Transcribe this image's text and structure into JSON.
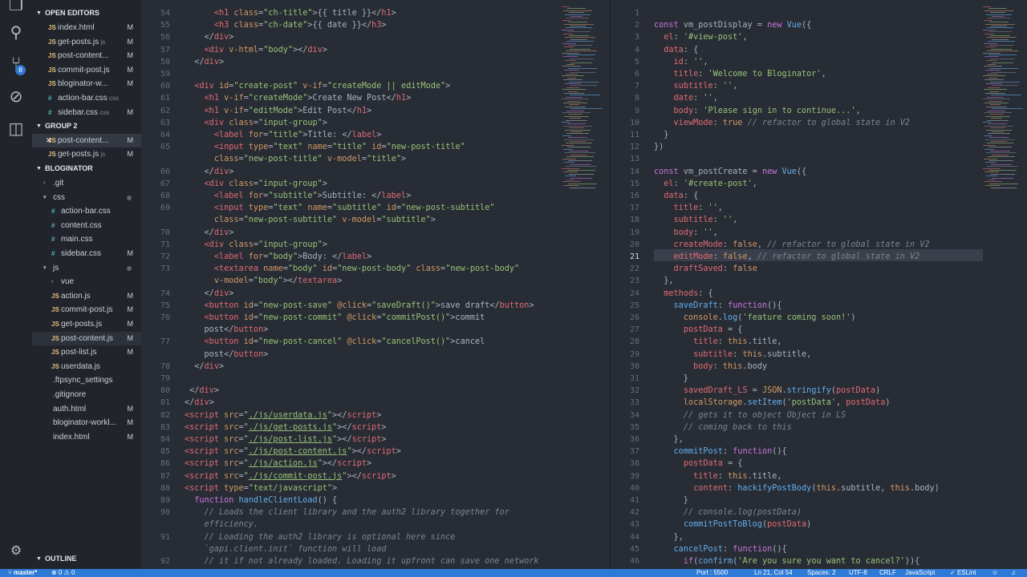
{
  "sidebar": {
    "open_editors": "OPEN EDITORS",
    "group2": "GROUP 2",
    "project": "BLOGINATOR",
    "outline": "OUTLINE",
    "open_files": [
      {
        "icon": "JS",
        "name": "index.html",
        "ext": "",
        "status": "M",
        "type": "html"
      },
      {
        "icon": "JS",
        "name": "get-posts.js",
        "ext": "js",
        "status": "M",
        "type": "js"
      },
      {
        "icon": "JS",
        "name": "post-content...",
        "ext": "",
        "status": "M",
        "type": "js"
      },
      {
        "icon": "JS",
        "name": "commit-post.js",
        "ext": "",
        "status": "M",
        "type": "js"
      },
      {
        "icon": "JS",
        "name": "bloginator-w...",
        "ext": "",
        "status": "M",
        "type": "js"
      },
      {
        "icon": "#",
        "name": "action-bar.css",
        "ext": "css",
        "status": "",
        "type": "css"
      },
      {
        "icon": "#",
        "name": "sidebar.css",
        "ext": "css",
        "status": "M",
        "type": "css"
      }
    ],
    "group2_files": [
      {
        "icon": "JS",
        "name": "post-content...",
        "status": "M"
      },
      {
        "icon": "JS",
        "name": "get-posts.js",
        "ext": "js",
        "status": "M"
      }
    ],
    "tree": [
      {
        "name": ".git",
        "indent": 1,
        "folder": true,
        "status": ""
      },
      {
        "name": "css",
        "indent": 1,
        "folder": true,
        "open": true,
        "status": "dot"
      },
      {
        "name": "action-bar.css",
        "indent": 2,
        "icon": "#",
        "status": ""
      },
      {
        "name": "content.css",
        "indent": 2,
        "icon": "#",
        "status": ""
      },
      {
        "name": "main.css",
        "indent": 2,
        "icon": "#",
        "status": ""
      },
      {
        "name": "sidebar.css",
        "indent": 2,
        "icon": "#",
        "status": "M"
      },
      {
        "name": "js",
        "indent": 1,
        "folder": true,
        "open": true,
        "status": "dot"
      },
      {
        "name": "vue",
        "indent": 2,
        "folder": true,
        "status": ""
      },
      {
        "name": "action.js",
        "indent": 2,
        "icon": "JS",
        "status": "M"
      },
      {
        "name": "commit-post.js",
        "indent": 2,
        "icon": "JS",
        "status": "M"
      },
      {
        "name": "get-posts.js",
        "indent": 2,
        "icon": "JS",
        "status": "M"
      },
      {
        "name": "post-content.js",
        "indent": 2,
        "icon": "JS",
        "status": "M"
      },
      {
        "name": "post-list.js",
        "indent": 2,
        "icon": "JS",
        "status": "M"
      },
      {
        "name": "userdata.js",
        "indent": 2,
        "icon": "JS",
        "status": ""
      },
      {
        "name": ".ftpsync_settings",
        "indent": 1,
        "icon": "",
        "status": ""
      },
      {
        "name": ".gitignore",
        "indent": 1,
        "icon": "",
        "status": ""
      },
      {
        "name": "auth.html",
        "indent": 1,
        "icon": "",
        "status": "M"
      },
      {
        "name": "bloginator-workl...",
        "indent": 1,
        "icon": "",
        "status": "M"
      },
      {
        "name": "index.html",
        "indent": 1,
        "icon": "",
        "status": "M"
      }
    ]
  },
  "status": {
    "branch": "master*",
    "errors": "0",
    "warnings": "0",
    "port": "Port : 5500",
    "position": "Ln 21, Col 54",
    "spaces": "Spaces: 2",
    "encoding": "UTF-8",
    "eol": "CRLF",
    "language": "JavaScript",
    "linter": "ESLint"
  },
  "editor1": {
    "lines": [
      {
        "n": "54",
        "h": "      <span class=t>&lt;h1</span> <span class=a>class</span>=<span class=s>\"ch-title\"</span>&gt;{{ title }}&lt;/<span class=t>h1</span>&gt;"
      },
      {
        "n": "55",
        "h": "      <span class=t>&lt;h3</span> <span class=a>class</span>=<span class=s>\"ch-date\"</span>&gt;{{ date }}&lt;/<span class=t>h3</span>&gt;"
      },
      {
        "n": "56",
        "h": "    &lt;/<span class=t>div</span>&gt;"
      },
      {
        "n": "57",
        "h": "    <span class=t>&lt;div</span> <span class=a>v-html</span>=<span class=s>\"body\"</span>&gt;&lt;/<span class=t>div</span>&gt;"
      },
      {
        "n": "58",
        "h": "  &lt;/<span class=t>div</span>&gt;"
      },
      {
        "n": "59",
        "h": ""
      },
      {
        "n": "60",
        "h": "  <span class=t>&lt;div</span> <span class=a>id</span>=<span class=s>\"create-post\"</span> <span class=a>v-if</span>=<span class=s>\"createMode || editMode\"</span>&gt;"
      },
      {
        "n": "61",
        "h": "    <span class=t>&lt;h1</span> <span class=a>v-if</span>=<span class=s>\"createMode\"</span>&gt;Create New Post&lt;/<span class=t>h1</span>&gt;"
      },
      {
        "n": "62",
        "h": "    <span class=t>&lt;h1</span> <span class=a>v-if</span>=<span class=s>\"editMode\"</span>&gt;Edit Post&lt;/<span class=t>h1</span>&gt;"
      },
      {
        "n": "63",
        "h": "    <span class=t>&lt;div</span> <span class=a>class</span>=<span class=s>\"input-group\"</span>&gt;"
      },
      {
        "n": "64",
        "h": "      <span class=t>&lt;label</span> <span class=a>for</span>=<span class=s>\"title\"</span>&gt;Title: &lt;/<span class=t>label</span>&gt;"
      },
      {
        "n": "65",
        "h": "      <span class=t>&lt;input</span> <span class=a>type</span>=<span class=s>\"text\"</span> <span class=a>name</span>=<span class=s>\"title\"</span> <span class=a>id</span>=<span class=s>\"new-post-title\"</span>"
      },
      {
        "n": "",
        "h": "      <span class=a>class</span>=<span class=s>\"new-post-title\"</span> <span class=a>v-model</span>=<span class=s>\"title\"</span>&gt;"
      },
      {
        "n": "66",
        "h": "    &lt;/<span class=t>div</span>&gt;"
      },
      {
        "n": "67",
        "h": "    <span class=t>&lt;div</span> <span class=a>class</span>=<span class=s>\"input-group\"</span>&gt;"
      },
      {
        "n": "68",
        "h": "      <span class=t>&lt;label</span> <span class=a>for</span>=<span class=s>\"subtitle\"</span>&gt;Subtitle: &lt;/<span class=t>label</span>&gt;"
      },
      {
        "n": "69",
        "h": "      <span class=t>&lt;input</span> <span class=a>type</span>=<span class=s>\"text\"</span> <span class=a>name</span>=<span class=s>\"subtitle\"</span> <span class=a>id</span>=<span class=s>\"new-post-subtitle\"</span>"
      },
      {
        "n": "",
        "h": "      <span class=a>class</span>=<span class=s>\"new-post-subtitle\"</span> <span class=a>v-model</span>=<span class=s>\"subtitle\"</span>&gt;"
      },
      {
        "n": "70",
        "h": "    &lt;/<span class=t>div</span>&gt;"
      },
      {
        "n": "71",
        "h": "    <span class=t>&lt;div</span> <span class=a>class</span>=<span class=s>\"input-group\"</span>&gt;"
      },
      {
        "n": "72",
        "h": "      <span class=t>&lt;label</span> <span class=a>for</span>=<span class=s>\"body\"</span>&gt;Body: &lt;/<span class=t>label</span>&gt;"
      },
      {
        "n": "73",
        "h": "      <span class=t>&lt;textarea</span> <span class=a>name</span>=<span class=s>\"body\"</span> <span class=a>id</span>=<span class=s>\"new-post-body\"</span> <span class=a>class</span>=<span class=s>\"new-post-body\"</span>"
      },
      {
        "n": "",
        "h": "      <span class=a>v-model</span>=<span class=s>\"body\"</span>&gt;&lt;/<span class=t>textarea</span>&gt;"
      },
      {
        "n": "74",
        "h": "    &lt;/<span class=t>div</span>&gt;"
      },
      {
        "n": "75",
        "h": "    <span class=t>&lt;button</span> <span class=a>id</span>=<span class=s>\"new-post-save\"</span> <span class=a>@click</span>=<span class=s>\"saveDraft()\"</span>&gt;save draft&lt;/<span class=t>button</span>&gt;"
      },
      {
        "n": "76",
        "h": "    <span class=t>&lt;button</span> <span class=a>id</span>=<span class=s>\"new-post-commit\"</span> <span class=a>@click</span>=<span class=s>\"commitPost()\"</span>&gt;commit"
      },
      {
        "n": "",
        "h": "    post&lt;/<span class=t>button</span>&gt;"
      },
      {
        "n": "77",
        "h": "    <span class=t>&lt;button</span> <span class=a>id</span>=<span class=s>\"new-post-cancel\"</span> <span class=a>@click</span>=<span class=s>\"cancelPost()\"</span>&gt;cancel"
      },
      {
        "n": "",
        "h": "    post&lt;/<span class=t>button</span>&gt;"
      },
      {
        "n": "78",
        "h": "  &lt;/<span class=t>div</span>&gt;"
      },
      {
        "n": "79",
        "h": ""
      },
      {
        "n": "80",
        "h": " &lt;/<span class=t>div</span>&gt;"
      },
      {
        "n": "81",
        "h": "&lt;/<span class=t>div</span>&gt;"
      },
      {
        "n": "82",
        "h": "<span class=t>&lt;script</span> <span class=a>src</span>=<span class=s>\"</span><span class=u>./js/userdata.js</span><span class=s>\"</span>&gt;&lt;/<span class=t>script</span>&gt;"
      },
      {
        "n": "83",
        "h": "<span class=t>&lt;script</span> <span class=a>src</span>=<span class=s>\"</span><span class=u>./js/get-posts.js</span><span class=s>\"</span>&gt;&lt;/<span class=t>script</span>&gt;"
      },
      {
        "n": "84",
        "h": "<span class=t>&lt;script</span> <span class=a>src</span>=<span class=s>\"</span><span class=u>./js/post-list.js</span><span class=s>\"</span>&gt;&lt;/<span class=t>script</span>&gt;"
      },
      {
        "n": "85",
        "h": "<span class=t>&lt;script</span> <span class=a>src</span>=<span class=s>\"</span><span class=u>./js/post-content.js</span><span class=s>\"</span>&gt;&lt;/<span class=t>script</span>&gt;"
      },
      {
        "n": "86",
        "h": "<span class=t>&lt;script</span> <span class=a>src</span>=<span class=s>\"</span><span class=u>./js/action.js</span><span class=s>\"</span>&gt;&lt;/<span class=t>script</span>&gt;"
      },
      {
        "n": "87",
        "h": "<span class=t>&lt;script</span> <span class=a>src</span>=<span class=s>\"</span><span class=u>./js/commit-post.js</span><span class=s>\"</span>&gt;&lt;/<span class=t>script</span>&gt;"
      },
      {
        "n": "88",
        "h": "<span class=t>&lt;script</span> <span class=a>type</span>=<span class=s>\"text/javascript\"</span>&gt;"
      },
      {
        "n": "89",
        "h": "  <span class=k>function</span> <span class=f>handleClientLoad</span>() {"
      },
      {
        "n": "90",
        "h": "    <span class=c>// Loads the client library and the auth2 library together for</span>"
      },
      {
        "n": "",
        "h": "    <span class=c>efficiency.</span>"
      },
      {
        "n": "91",
        "h": "    <span class=c>// Loading the auth2 library is optional here since</span>"
      },
      {
        "n": "",
        "h": "    <span class=c>`gapi.client.init` function will load</span>"
      },
      {
        "n": "92",
        "h": "    <span class=c>// it if not already loaded. Loading it upfront can save one network</span>"
      }
    ]
  },
  "editor2": {
    "lines": [
      {
        "n": "1",
        "h": ""
      },
      {
        "n": "2",
        "h": "<span class=k>const</span> vm_postDisplay = <span class=k>new</span> <span class=f>Vue</span>({"
      },
      {
        "n": "3",
        "h": "  <span class=i>el</span>: <span class=s>'#view-post'</span>,"
      },
      {
        "n": "4",
        "h": "  <span class=i>data</span>: {"
      },
      {
        "n": "5",
        "h": "    <span class=i>id</span>: <span class=s>''</span>,"
      },
      {
        "n": "6",
        "h": "    <span class=i>title</span>: <span class=s>'Welcome to Bloginator'</span>,"
      },
      {
        "n": "7",
        "h": "    <span class=i>subtitle</span>: <span class=s>''</span>,"
      },
      {
        "n": "8",
        "h": "    <span class=i>date</span>: <span class=s>''</span>,"
      },
      {
        "n": "9",
        "h": "    <span class=i>body</span>: <span class=s>'Please sign in to continue...'</span>,"
      },
      {
        "n": "10",
        "h": "    <span class=i>viewMode</span>: <span class=n>true</span> <span class=c>// refactor to global state in V2</span>"
      },
      {
        "n": "11",
        "h": "  }"
      },
      {
        "n": "12",
        "h": "})"
      },
      {
        "n": "13",
        "h": ""
      },
      {
        "n": "14",
        "h": "<span class=k>const</span> vm_postCreate = <span class=k>new</span> <span class=f>Vue</span>({"
      },
      {
        "n": "15",
        "h": "  <span class=i>el</span>: <span class=s>'#create-post'</span>,"
      },
      {
        "n": "16",
        "h": "  <span class=i>data</span>: {"
      },
      {
        "n": "17",
        "h": "    <span class=i>title</span>: <span class=s>''</span>,"
      },
      {
        "n": "18",
        "h": "    <span class=i>subtitle</span>: <span class=s>''</span>,"
      },
      {
        "n": "19",
        "h": "    <span class=i>body</span>: <span class=s>''</span>,"
      },
      {
        "n": "20",
        "h": "    <span class=i>createMode</span>: <span class=n>false</span>, <span class=c>// refactor to global state in V2</span>"
      },
      {
        "n": "21",
        "h": "    <span class=i>editMode</span>: <span class=n>false</span>, <span class=c>// refactor to global state in V2</span>"
      },
      {
        "n": "22",
        "h": "    <span class=i>draftSaved</span>: <span class=n>false</span>"
      },
      {
        "n": "23",
        "h": "  },"
      },
      {
        "n": "24",
        "h": "  <span class=i>methods</span>: {"
      },
      {
        "n": "25",
        "h": "    <span class=f>saveDraft</span>: <span class=k>function</span>(){"
      },
      {
        "n": "26",
        "h": "      <span class=n>console</span>.<span class=f>log</span>(<span class=s>'feature coming soon!'</span>)"
      },
      {
        "n": "27",
        "h": "      <span class=i>postData</span> = {"
      },
      {
        "n": "28",
        "h": "        <span class=i>title</span>: <span class=n>this</span>.title,"
      },
      {
        "n": "29",
        "h": "        <span class=i>subtitle</span>: <span class=n>this</span>.subtitle,"
      },
      {
        "n": "30",
        "h": "        <span class=i>body</span>: <span class=n>this</span>.body"
      },
      {
        "n": "31",
        "h": "      }"
      },
      {
        "n": "32",
        "h": "      <span class=i>savedDraft_LS</span> = <span class=n>JSON</span>.<span class=f>stringify</span>(<span class=i>postData</span>)"
      },
      {
        "n": "33",
        "h": "      <span class=n>localStorage</span>.<span class=f>setItem</span>(<span class=s>'postData'</span>, <span class=i>postData</span>)"
      },
      {
        "n": "34",
        "h": "      <span class=c>// gets it to object Object in LS</span>"
      },
      {
        "n": "35",
        "h": "      <span class=c>// coming back to this</span>"
      },
      {
        "n": "36",
        "h": "    },"
      },
      {
        "n": "37",
        "h": "    <span class=f>commitPost</span>: <span class=k>function</span>(){"
      },
      {
        "n": "38",
        "h": "      <span class=i>postData</span> = {"
      },
      {
        "n": "39",
        "h": "        <span class=i>title</span>: <span class=n>this</span>.title,"
      },
      {
        "n": "40",
        "h": "        <span class=i>content</span>: <span class=f>hackifyPostBody</span>(<span class=n>this</span>.subtitle, <span class=n>this</span>.body)"
      },
      {
        "n": "41",
        "h": "      }"
      },
      {
        "n": "42",
        "h": "      <span class=c>// console.log(postData)</span>"
      },
      {
        "n": "43",
        "h": "      <span class=f>commitPostToBlog</span>(<span class=i>postData</span>)"
      },
      {
        "n": "44",
        "h": "    },"
      },
      {
        "n": "45",
        "h": "    <span class=f>cancelPost</span>: <span class=k>function</span>(){"
      },
      {
        "n": "46",
        "h": "      <span class=k>if</span>(<span class=f>confirm</span>(<span class=s>'Are you sure you want to cancel?'</span>)){"
      }
    ]
  }
}
